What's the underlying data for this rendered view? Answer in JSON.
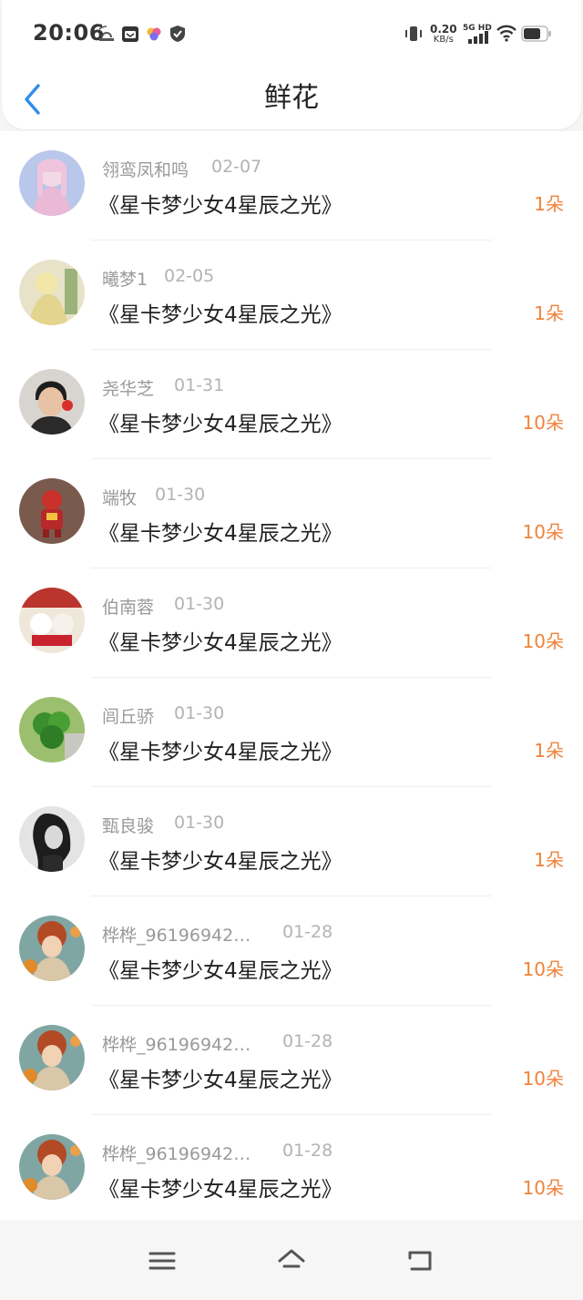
{
  "status_bar": {
    "time": "20:06",
    "speed_value": "0.20",
    "speed_unit": "KB/s",
    "network": "5G HD",
    "icons": [
      "cast-icon",
      "calendar-icon",
      "app-icon",
      "shield-icon",
      "vibrate-icon",
      "signal-icon",
      "wifi-icon",
      "battery-icon"
    ]
  },
  "header": {
    "title": "鲜花",
    "back_icon": "chevron-left-icon"
  },
  "colors": {
    "accent": "#2f8ee8",
    "count": "#f0833a",
    "meta": "#9a9a9a"
  },
  "rows": [
    {
      "user": "翎鸾凤和鸣",
      "date": "02-07",
      "book": "《星卡梦少女4星辰之光》",
      "count": "1朵"
    },
    {
      "user": "曦梦1",
      "date": "02-05",
      "book": "《星卡梦少女4星辰之光》",
      "count": "1朵"
    },
    {
      "user": "尧华芝",
      "date": "01-31",
      "book": "《星卡梦少女4星辰之光》",
      "count": "10朵"
    },
    {
      "user": "端牧",
      "date": "01-30",
      "book": "《星卡梦少女4星辰之光》",
      "count": "10朵"
    },
    {
      "user": "伯南蓉",
      "date": "01-30",
      "book": "《星卡梦少女4星辰之光》",
      "count": "10朵"
    },
    {
      "user": "闾丘骄",
      "date": "01-30",
      "book": "《星卡梦少女4星辰之光》",
      "count": "1朵"
    },
    {
      "user": "甄良骏",
      "date": "01-30",
      "book": "《星卡梦少女4星辰之光》",
      "count": "1朵"
    },
    {
      "user": "桦桦_96196942…",
      "date": "01-28",
      "book": "《星卡梦少女4星辰之光》",
      "count": "10朵"
    },
    {
      "user": "桦桦_96196942…",
      "date": "01-28",
      "book": "《星卡梦少女4星辰之光》",
      "count": "10朵"
    },
    {
      "user": "桦桦_96196942…",
      "date": "01-28",
      "book": "《星卡梦少女4星辰之光》",
      "count": "10朵"
    }
  ],
  "bottom_nav": {
    "icons": [
      "menu-icon",
      "home-icon",
      "back-icon"
    ]
  }
}
